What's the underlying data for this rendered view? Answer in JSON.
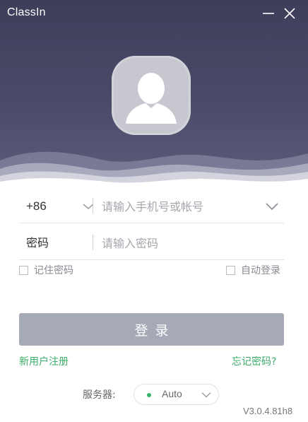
{
  "app": {
    "title": "ClassIn",
    "version": "V3.0.4.81h8"
  },
  "window_controls": {
    "minimize": "minimize-icon",
    "close": "close-icon"
  },
  "header": {
    "avatar_icon": "user-avatar-icon",
    "background": "#4a4966"
  },
  "phone": {
    "country_code": "+86",
    "placeholder": "请输入手机号或帐号",
    "value": ""
  },
  "password": {
    "label": "密码",
    "placeholder": "请输入密码",
    "value": ""
  },
  "options": {
    "remember_password": {
      "label": "记住密码",
      "checked": false
    },
    "auto_login": {
      "label": "自动登录",
      "checked": false
    }
  },
  "login_button": {
    "label": "登录",
    "color": "#a6a9b6"
  },
  "links": {
    "register": "新用户注册",
    "forgot": "忘记密码?",
    "color": "#3cad6a"
  },
  "server": {
    "label": "服务器:",
    "value": "Auto",
    "status_color": "#36b36e"
  }
}
